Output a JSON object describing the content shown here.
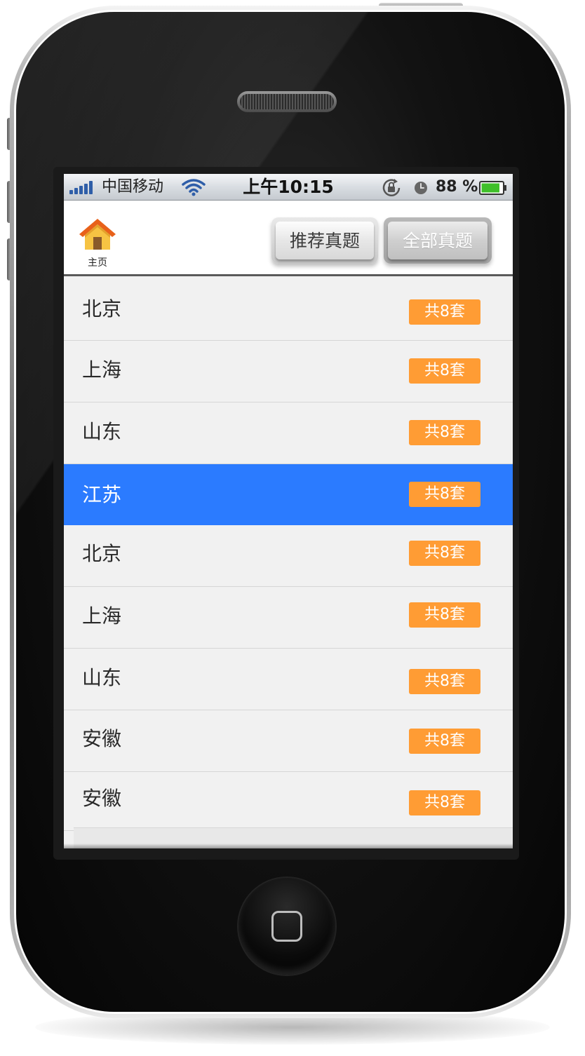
{
  "status_bar": {
    "carrier": "中国移动",
    "time": "上午10:15",
    "battery_percent": "88 %",
    "battery_level": 0.88,
    "icons": [
      "signal-bars-icon",
      "wifi-icon",
      "rotation-lock-icon",
      "alarm-icon",
      "battery-icon"
    ]
  },
  "header": {
    "home_label": "主页",
    "home_icon": "house-icon",
    "tabs": [
      {
        "label": "推荐真题",
        "state": "normal"
      },
      {
        "label": "全部真题",
        "state": "active"
      }
    ]
  },
  "list": {
    "items": [
      {
        "name": "北京",
        "count": "共8套"
      },
      {
        "name": "上海",
        "count": "共8套"
      },
      {
        "name": "山东",
        "count": "共8套"
      },
      {
        "name": "江苏",
        "count": "共8套",
        "selected": true
      },
      {
        "name": "北京",
        "count": "共8套"
      },
      {
        "name": "上海",
        "count": "共8套"
      },
      {
        "name": "山东",
        "count": "共8套"
      },
      {
        "name": "安徽",
        "count": "共8套"
      },
      {
        "name": "安徽",
        "count": "共8套"
      }
    ]
  },
  "colors": {
    "selected_row": "#2b7bff",
    "badge": "#ff9c34",
    "list_background": "#f1f1f1"
  }
}
